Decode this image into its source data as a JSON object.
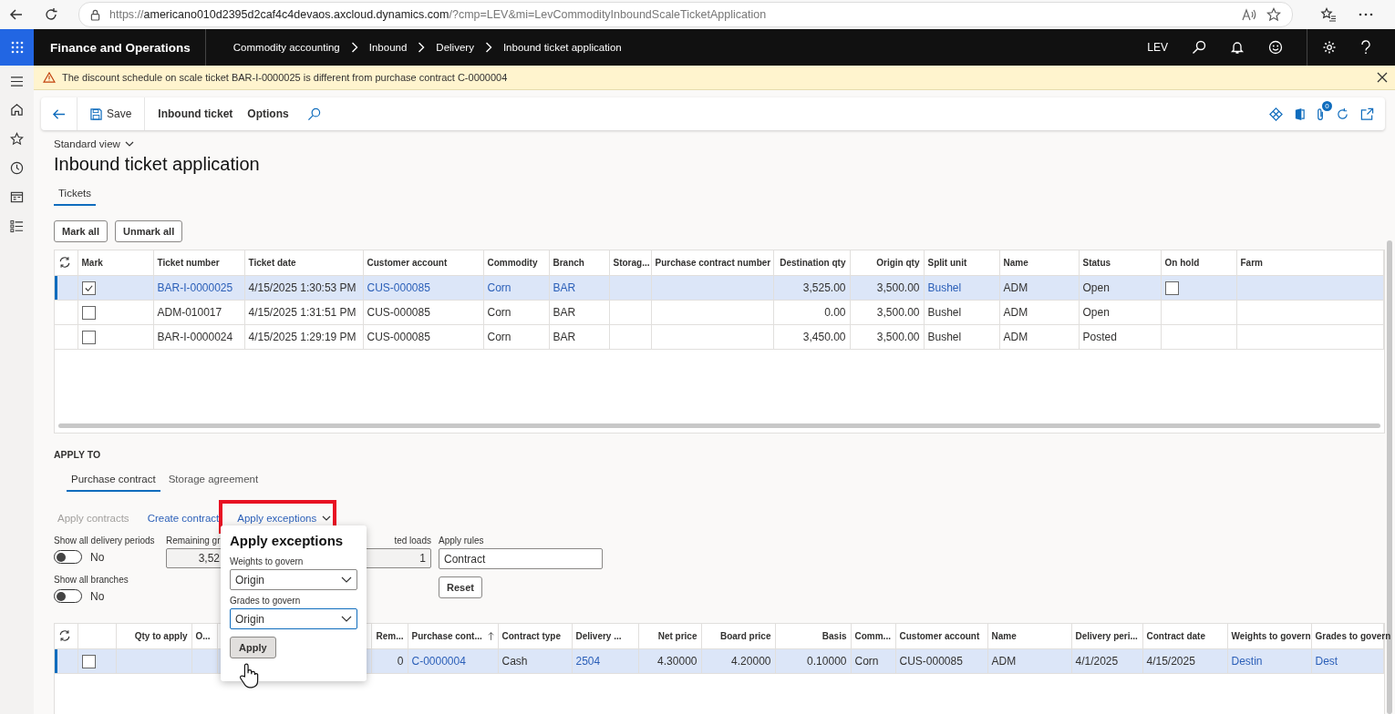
{
  "browser": {
    "url_scheme": "https://",
    "url_host": "americano010d2395d2caf4c4devaos.axcloud.dynamics.com",
    "url_path": "/?cmp=LEV&mi=LevCommodityInboundScaleTicketApplication"
  },
  "nav": {
    "app_title": "Finance and Operations",
    "breadcrumbs": [
      "Commodity accounting",
      "Inbound",
      "Delivery",
      "Inbound ticket application"
    ],
    "user": "LEV"
  },
  "notification": {
    "kind": "warning",
    "message": "The discount schedule on scale ticket BAR-I-0000025 is different from purchase contract C-0000004"
  },
  "action_pane": {
    "items": [
      {
        "kind": "save",
        "label": "Save"
      },
      {
        "kind": "menu",
        "label": "Inbound ticket"
      },
      {
        "kind": "menu",
        "label": "Options"
      }
    ],
    "attachments_count": "0"
  },
  "page": {
    "view": "Standard view",
    "title": "Inbound ticket application",
    "tabs": [
      {
        "label": "Tickets",
        "selected": true
      }
    ]
  },
  "ticket_buttons": [
    "Mark all",
    "Unmark all"
  ],
  "tickets_table": {
    "columns": [
      "Mark",
      "Ticket number",
      "Ticket date",
      "Customer account",
      "Commodity",
      "Branch",
      "Storag...",
      "Purchase contract number",
      "Destination qty",
      "Origin qty",
      "Split unit",
      "Name",
      "Status",
      "On hold",
      "Farm"
    ],
    "rows": [
      {
        "selected": true,
        "mark": true,
        "on_hold": false,
        "ticket_number": "BAR-I-0000025",
        "ticket_date": "4/15/2025 1:30:53 PM",
        "customer_account": "CUS-000085",
        "commodity": "Corn",
        "branch": "BAR",
        "destination_qty": "3,525.00",
        "origin_qty": "3,500.00",
        "split_unit": "Bushel",
        "name": "ADM",
        "status": "Open"
      },
      {
        "selected": false,
        "mark": false,
        "ticket_number": "ADM-010017",
        "ticket_date": "4/15/2025 1:31:51 PM",
        "customer_account": "CUS-000085",
        "commodity": "Corn",
        "branch": "BAR",
        "destination_qty": "0.00",
        "origin_qty": "3,500.00",
        "split_unit": "Bushel",
        "name": "ADM",
        "status": "Open"
      },
      {
        "selected": false,
        "mark": false,
        "ticket_number": "BAR-I-0000024",
        "ticket_date": "4/15/2025 1:29:19 PM",
        "customer_account": "CUS-000085",
        "commodity": "Corn",
        "branch": "BAR",
        "destination_qty": "3,450.00",
        "origin_qty": "3,500.00",
        "split_unit": "Bushel",
        "name": "ADM",
        "status": "Posted"
      }
    ]
  },
  "apply_to": {
    "heading": "APPLY TO",
    "tabs": [
      {
        "label": "Purchase contract",
        "selected": true
      },
      {
        "label": "Storage agreement",
        "selected": false
      }
    ],
    "actions": [
      {
        "label": "Apply contracts",
        "disabled": true,
        "dropdown": false,
        "highlighted": false
      },
      {
        "label": "Create contract",
        "disabled": false,
        "dropdown": false,
        "highlighted": false
      },
      {
        "label": "Apply exceptions",
        "disabled": false,
        "dropdown": true,
        "highlighted": true
      }
    ],
    "toggles": [
      {
        "label": "Show all delivery periods",
        "on": false,
        "text": "No"
      },
      {
        "label": "Show all branches",
        "on": false,
        "text": "No"
      }
    ],
    "remaining": {
      "label": "Remaining gr",
      "value": "3,52"
    },
    "loads": {
      "label": "ted loads",
      "value": "1"
    },
    "apply_rules": {
      "label": "Apply rules",
      "value": "Contract"
    },
    "reset": "Reset"
  },
  "popup": {
    "title": "Apply exceptions",
    "fields": [
      {
        "label": "Weights to govern",
        "value": "Origin",
        "focused": false
      },
      {
        "label": "Grades to govern",
        "value": "Origin",
        "focused": true
      }
    ],
    "button": "Apply"
  },
  "contracts_table": {
    "columns": [
      "Qty to apply",
      "O...",
      "Rem...",
      "Purchase cont...",
      "Contract type",
      "Delivery ...",
      "Net price",
      "Board price",
      "Basis",
      "Comm...",
      "Customer account",
      "Name",
      "Delivery peri...",
      "Contract date",
      "Weights to govern",
      "Grades to govern"
    ],
    "rows": [
      {
        "selected": true,
        "checked": false,
        "remaining": "0",
        "purchase_contract": "C-0000004",
        "contract_type": "Cash",
        "delivery": "2504",
        "net_price": "4.30000",
        "board_price": "4.20000",
        "basis": "0.10000",
        "commodity": "Corn",
        "customer_account": "CUS-000085",
        "name": "ADM",
        "delivery_period": "4/1/2025",
        "contract_date": "4/15/2025",
        "weights_to_govern": "Destin",
        "grades_to_govern": "Dest"
      }
    ]
  }
}
